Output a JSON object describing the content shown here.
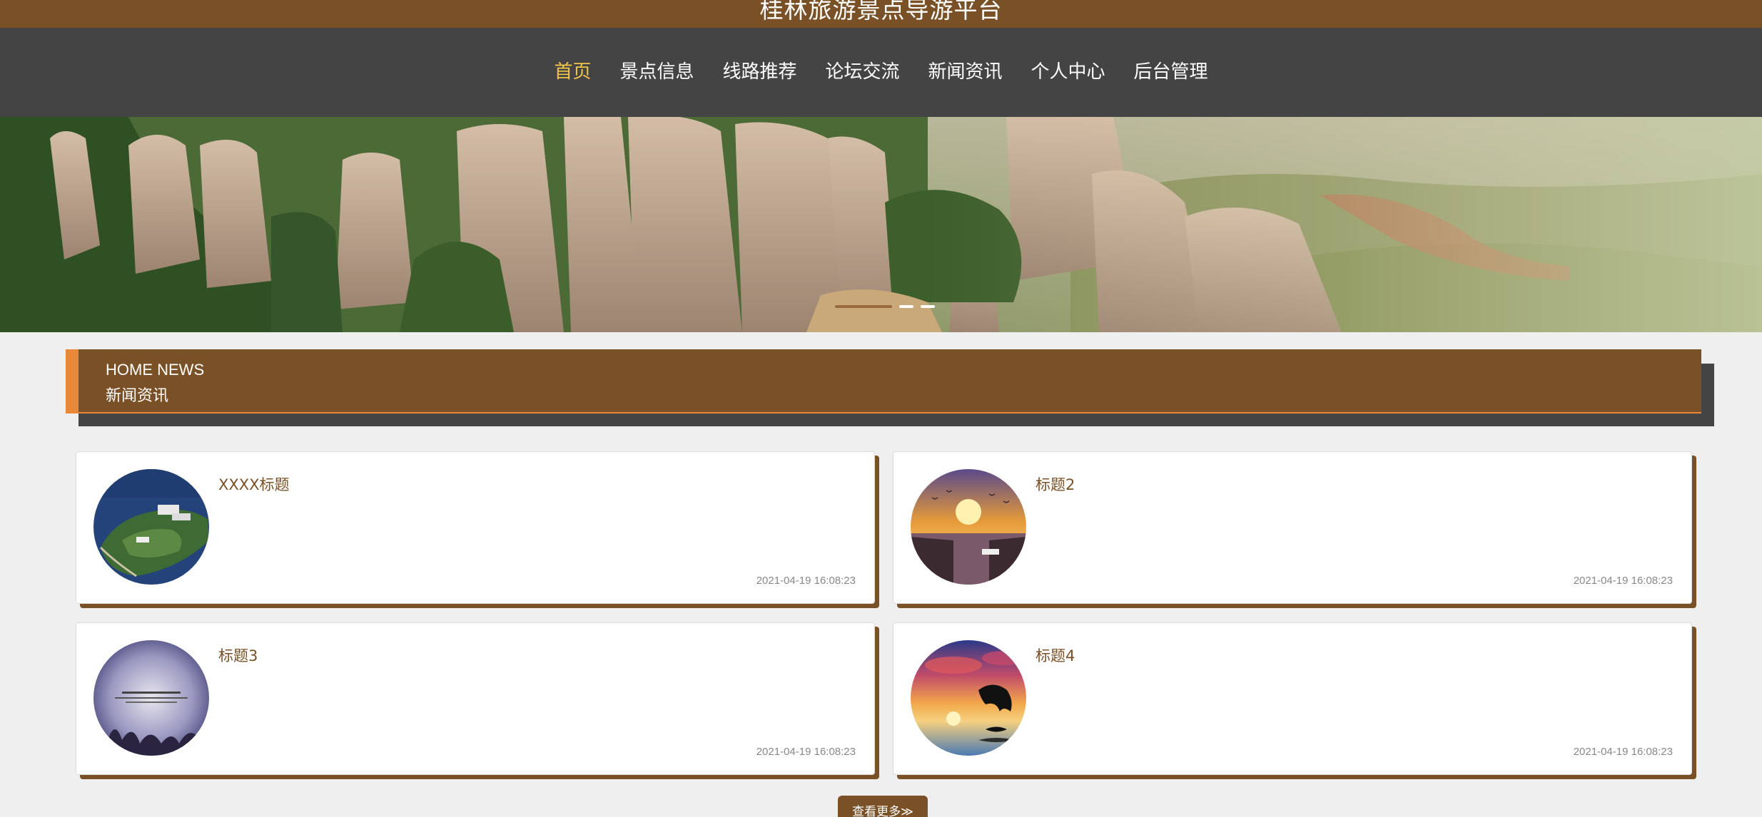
{
  "header": {
    "site_title": "桂林旅游景点导游平台"
  },
  "nav": {
    "items": [
      {
        "label": "首页",
        "active": true
      },
      {
        "label": "景点信息"
      },
      {
        "label": "线路推荐"
      },
      {
        "label": "论坛交流"
      },
      {
        "label": "新闻资讯"
      },
      {
        "label": "个人中心"
      },
      {
        "label": "后台管理"
      }
    ]
  },
  "banner": {
    "slide_count": 3,
    "active_slide": 1
  },
  "news_section": {
    "heading_en": "HOME NEWS",
    "heading_cn": "新闻资讯",
    "items": [
      {
        "title": "XXXX标题",
        "time": "2021-04-19 16:08:23",
        "image": "island-aerial"
      },
      {
        "title": "标题2",
        "time": "2021-04-19 16:08:23",
        "image": "sunset-river"
      },
      {
        "title": "标题3",
        "time": "2021-04-19 16:08:23",
        "image": "calligraphy-sky"
      },
      {
        "title": "标题4",
        "time": "2021-04-19 16:08:23",
        "image": "dolphin-sunset"
      }
    ],
    "more_label": "查看更多≫"
  },
  "colors": {
    "brand_brown": "#7a5127",
    "nav_bg": "#444444",
    "accent_orange": "#e8893a",
    "active_nav": "#f1c44a"
  }
}
